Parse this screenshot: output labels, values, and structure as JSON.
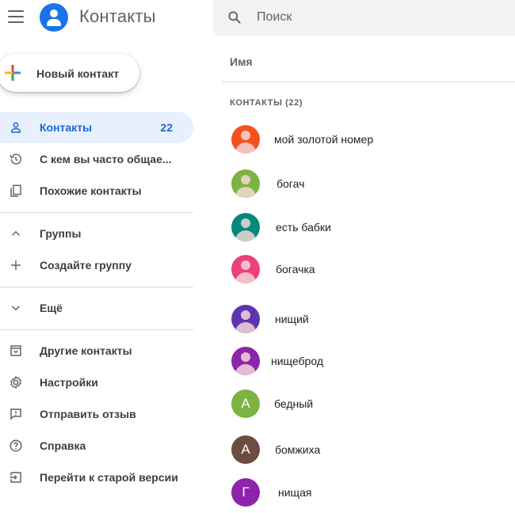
{
  "app": {
    "title": "Контакты"
  },
  "search": {
    "placeholder": "Поиск"
  },
  "new_contact": {
    "label": "Новый контакт"
  },
  "sidebar": {
    "items": [
      {
        "label": "Контакты",
        "count": "22",
        "icon": "person-icon",
        "active": true
      },
      {
        "label": "С кем вы часто общае...",
        "icon": "history-icon"
      },
      {
        "label": "Похожие контакты",
        "icon": "copy-icon"
      },
      {
        "label": "Группы",
        "icon": "chevron-up-icon"
      },
      {
        "label": "Создайте группу",
        "icon": "plus-icon"
      },
      {
        "label": "Ещё",
        "icon": "chevron-down-icon"
      },
      {
        "label": "Другие контакты",
        "icon": "archive-icon"
      },
      {
        "label": "Настройки",
        "icon": "gear-icon"
      },
      {
        "label": "Отправить отзыв",
        "icon": "feedback-icon"
      },
      {
        "label": "Справка",
        "icon": "help-icon"
      },
      {
        "label": "Перейти к старой версии",
        "icon": "exit-icon"
      }
    ]
  },
  "list": {
    "column_header": "Имя",
    "section_title": "КОНТАКТЫ (22)",
    "contacts": [
      {
        "name": "мой золотой номер",
        "avatar_color": "#f4511e",
        "avatar_type": "person"
      },
      {
        "name": "богач",
        "avatar_color": "#7cb342",
        "avatar_type": "person"
      },
      {
        "name": "есть бабки",
        "avatar_color": "#00897b",
        "avatar_type": "person"
      },
      {
        "name": "богачка",
        "avatar_color": "#ec407a",
        "avatar_type": "person"
      },
      {
        "name": "нищий",
        "avatar_color": "#5e35b1",
        "avatar_type": "person"
      },
      {
        "name": "нищеброд",
        "avatar_color": "#8e24aa",
        "avatar_type": "person"
      },
      {
        "name": "бедный",
        "avatar_color": "#7cb342",
        "avatar_type": "letter",
        "letter": "А"
      },
      {
        "name": "бомжиха",
        "avatar_color": "#6d4c41",
        "avatar_type": "letter",
        "letter": "А"
      },
      {
        "name": "нищая",
        "avatar_color": "#8e24aa",
        "avatar_type": "letter",
        "letter": "Г"
      }
    ]
  },
  "colors": {
    "accent": "#1a73e8",
    "active_bg": "#e8f0fe",
    "active_text": "#1967d2"
  }
}
